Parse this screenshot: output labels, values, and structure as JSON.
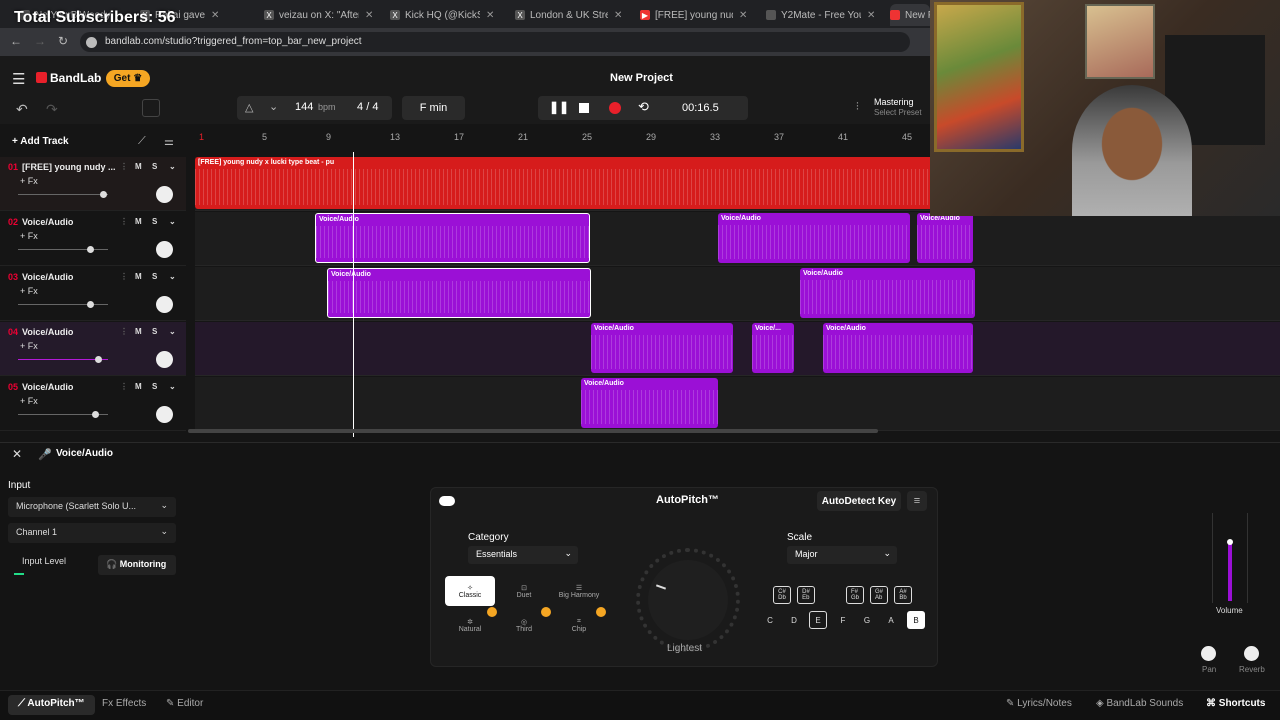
{
  "overlay": {
    "subscribers": "Total Subscribers: 56"
  },
  "browser": {
    "tabs": [
      {
        "label": "NetYourBiWoody"
      },
      {
        "label": "Rakai gave"
      },
      {
        "label": "veizau on X: \"After us"
      },
      {
        "label": "Kick HQ (@KickStream"
      },
      {
        "label": "London & UK Street"
      },
      {
        "label": "[FREE] young nudy x"
      },
      {
        "label": "Y2Mate - Free YouTub"
      },
      {
        "label": "New Pr"
      }
    ],
    "url": "bandlab.com/studio?triggered_from=top_bar_new_project"
  },
  "app": {
    "brand": "BandLab",
    "get_label": "Get",
    "project_title": "New Project",
    "bpm": "144",
    "bpm_unit": "bpm",
    "time_sig_num": "4",
    "time_sig_sep": "/",
    "time_sig_den": "4",
    "key": "F min",
    "time": "00:16.5",
    "mastering_label": "Mastering",
    "mastering_sub": "Select Preset",
    "add_track": "Add Track"
  },
  "ruler": {
    "ticks": [
      "1",
      "5",
      "9",
      "13",
      "17",
      "21",
      "25",
      "29",
      "33",
      "37",
      "41",
      "45"
    ]
  },
  "tracks": [
    {
      "num": "01",
      "name": "[FREE] young nudy ...",
      "fx": "+ Fx",
      "m": "M",
      "s": "S"
    },
    {
      "num": "02",
      "name": "Voice/Audio",
      "fx": "+ Fx",
      "m": "M",
      "s": "S"
    },
    {
      "num": "03",
      "name": "Voice/Audio",
      "fx": "+ Fx",
      "m": "M",
      "s": "S"
    },
    {
      "num": "04",
      "name": "Voice/Audio",
      "fx": "+ Fx",
      "m": "M",
      "s": "S"
    },
    {
      "num": "05",
      "name": "Voice/Audio",
      "fx": "+ Fx",
      "m": "M",
      "s": "S"
    }
  ],
  "clips": {
    "beat": "[FREE] young nudy x lucki type beat - pu",
    "voice": "Voice/Audio",
    "voice_short": "Voice/..."
  },
  "panel": {
    "title": "Voice/Audio",
    "input_label": "Input",
    "input_device": "Microphone (Scarlett Solo U...",
    "channel": "Channel 1",
    "input_level": "Input Level",
    "monitoring": "Monitoring",
    "autopitch_title": "AutoPitch™",
    "autodetect": "AutoDetect Key",
    "category_label": "Category",
    "category_value": "Essentials",
    "scale_label": "Scale",
    "scale_value": "Major",
    "presets": [
      "Classic",
      "Duet",
      "Big Harmony",
      "Natural",
      "Third",
      "Chip"
    ],
    "knob_label": "Lightest",
    "sharps": [
      "C#\nDb",
      "D#\nEb",
      "F#\nGb",
      "G#\nAb",
      "A#\nBb"
    ],
    "naturals": [
      "C",
      "D",
      "E",
      "F",
      "G",
      "A",
      "B"
    ],
    "volume": "Volume",
    "pan": "Pan",
    "reverb": "Reverb"
  },
  "bottom": {
    "autopitch": "AutoPitch™",
    "effects": "Effects",
    "editor": "Editor",
    "lyrics": "Lyrics/Notes",
    "sounds": "BandLab Sounds",
    "shortcuts": "Shortcuts"
  },
  "colors": {
    "accent": "#e8202a",
    "clip_purple": "#9b10d6",
    "beat_red": "#d61c1c",
    "get_btn": "#f5a623"
  }
}
